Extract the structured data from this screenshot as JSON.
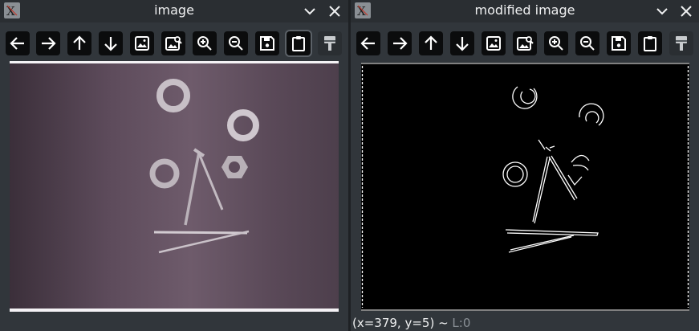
{
  "windows": [
    {
      "title": "image"
    },
    {
      "title": "modified image"
    }
  ],
  "toolbar": {
    "tools": [
      "arrow-left-icon",
      "arrow-right-icon",
      "arrow-up-icon",
      "arrow-down-icon",
      "image-icon",
      "image-search-icon",
      "zoom-in-icon",
      "zoom-out-icon",
      "save-icon",
      "clipboard-icon",
      "paint-brush-icon"
    ]
  },
  "status": {
    "coordinates": "(x=379, y=5) ~ ",
    "level": "L:0"
  },
  "colors": {
    "background": "#31363b",
    "titlebar": "#2a2e32",
    "toolbar_button": "#0b0c0d",
    "source_backdrop": "#5b4a5a",
    "edge_output": "#ffffff"
  }
}
